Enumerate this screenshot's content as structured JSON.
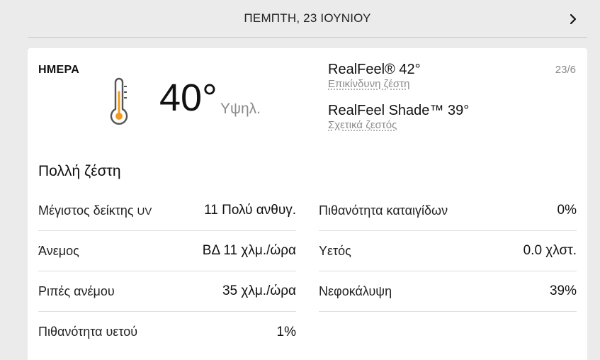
{
  "header": {
    "date": "ΠΕΜΠΤΗ, 23 ΙΟΥΝΙΟΥ",
    "next_icon": "chevron-right-icon"
  },
  "day": {
    "label": "ΗΜΕΡΑ",
    "icon": "thermometer-hot-icon",
    "temperature": "40°",
    "temperature_label": "Υψηλ.",
    "date_short": "23/6",
    "realfeel": "RealFeel® 42°",
    "realfeel_desc": "Επικίνδυνη ζέστη",
    "realfeel_shade": "RealFeel Shade™ 39°",
    "realfeel_shade_desc": "Σχετικά ζεστός",
    "phrase": "Πολλή ζέστη"
  },
  "details": {
    "left": [
      {
        "label": "Μέγιστος δείκτης ",
        "label_small": "UV",
        "value": "11 Πολύ ανθυγ."
      },
      {
        "label": "Άνεμος",
        "label_small": "",
        "value": "ΒΔ 11 χλμ./ώρα"
      },
      {
        "label": "Ριπές ανέμου",
        "label_small": "",
        "value": "35 χλμ./ώρα"
      },
      {
        "label": "Πιθανότητα υετού",
        "label_small": "",
        "value": "1%"
      }
    ],
    "right": [
      {
        "label": "Πιθανότητα καταιγίδων",
        "value": "0%"
      },
      {
        "label": "Υετός",
        "value": "0.0 χλστ."
      },
      {
        "label": "Νεφοκάλυψη",
        "value": "39%"
      }
    ]
  },
  "colors": {
    "accent_orange": "#f29c1f",
    "page_bg": "#ebebeb",
    "card_bg": "#ffffff"
  }
}
